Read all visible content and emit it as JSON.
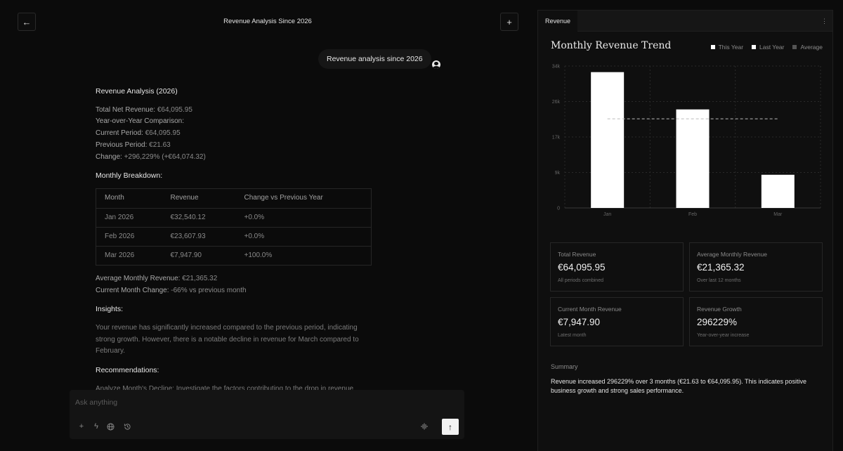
{
  "header": {
    "title": "Revenue Analysis Since 2026",
    "back_icon": "arrow-left-icon",
    "new_icon": "plus-icon"
  },
  "user_message": "Revenue analysis since 2026",
  "answer": {
    "heading": "Revenue Analysis (2026)",
    "total_net_label": "Total Net Revenue:",
    "total_net_value": " €64,095.95",
    "yoy_label": "Year-over-Year Comparison:",
    "current_label": "Current Period:",
    "current_value": " €64,095.95",
    "previous_label": "Previous Period:",
    "previous_value": " €21.63",
    "change_label": "Change:",
    "change_value": " +296,229% (+€64,074.32)",
    "breakdown_heading": "Monthly Breakdown:",
    "table": {
      "headers": [
        "Month",
        "Revenue",
        "Change vs Previous Year"
      ],
      "rows": [
        [
          "Jan 2026",
          "€32,540.12",
          "+0.0%"
        ],
        [
          "Feb 2026",
          "€23,607.93",
          "+0.0%"
        ],
        [
          "Mar 2026",
          "€7,947.90",
          "+100.0%"
        ]
      ]
    },
    "avg_label": "Average Monthly Revenue:",
    "avg_value": " €21,365.32",
    "cur_month_label": "Current Month Change:",
    "cur_month_value": " -66% vs previous month",
    "insights_heading": "Insights:",
    "insights_l1": "Your revenue has significantly increased compared to the previous period, indicating",
    "insights_l2": "strong growth. However, there is a notable decline in revenue for March compared to",
    "insights_l3": "February.",
    "recommendations_heading": "Recommendations:",
    "rec_partial": "Analyze Month's Decline: Investigate the factors contributing to the drop in revenue"
  },
  "composer": {
    "placeholder": "Ask anything",
    "icons": [
      "plus-icon",
      "bolt-icon",
      "globe-icon",
      "history-icon",
      "voice-icon",
      "arrow-up-icon"
    ]
  },
  "panel": {
    "tab_label": "Revenue",
    "chart_title": "Monthly Revenue Trend",
    "legend": [
      {
        "label": "This Year",
        "color": "#ffffff"
      },
      {
        "label": "Last Year",
        "color": "#ffffff"
      },
      {
        "label": "Average",
        "color": "#555555"
      }
    ],
    "cards": [
      {
        "title": "Total Revenue",
        "value": "€64,095.95",
        "sub": "All periods combined"
      },
      {
        "title": "Average Monthly Revenue",
        "value": "€21,365.32",
        "sub": "Over last 12 months"
      },
      {
        "title": "Current Month Revenue",
        "value": "€7,947.90",
        "sub": "Latest month"
      },
      {
        "title": "Revenue Growth",
        "value": "296229%",
        "sub": "Year-over-year increase"
      }
    ],
    "summary_label": "Summary",
    "summary_text": "Revenue increased 296229% over 3 months (€21.63 to €64,095.95). This indicates positive business growth and strong sales performance."
  },
  "chart_data": {
    "type": "bar",
    "categories": [
      "Jan",
      "Feb",
      "Mar"
    ],
    "series": [
      {
        "name": "This Year",
        "values": [
          32540.12,
          23607.93,
          7947.9
        ]
      }
    ],
    "average": 21365.32,
    "yticks": [
      "0",
      "9k",
      "17k",
      "26k",
      "34k"
    ],
    "ytick_values": [
      0,
      8500,
      17000,
      25500,
      34000
    ],
    "ylim": [
      0,
      34000
    ],
    "grid": true
  }
}
